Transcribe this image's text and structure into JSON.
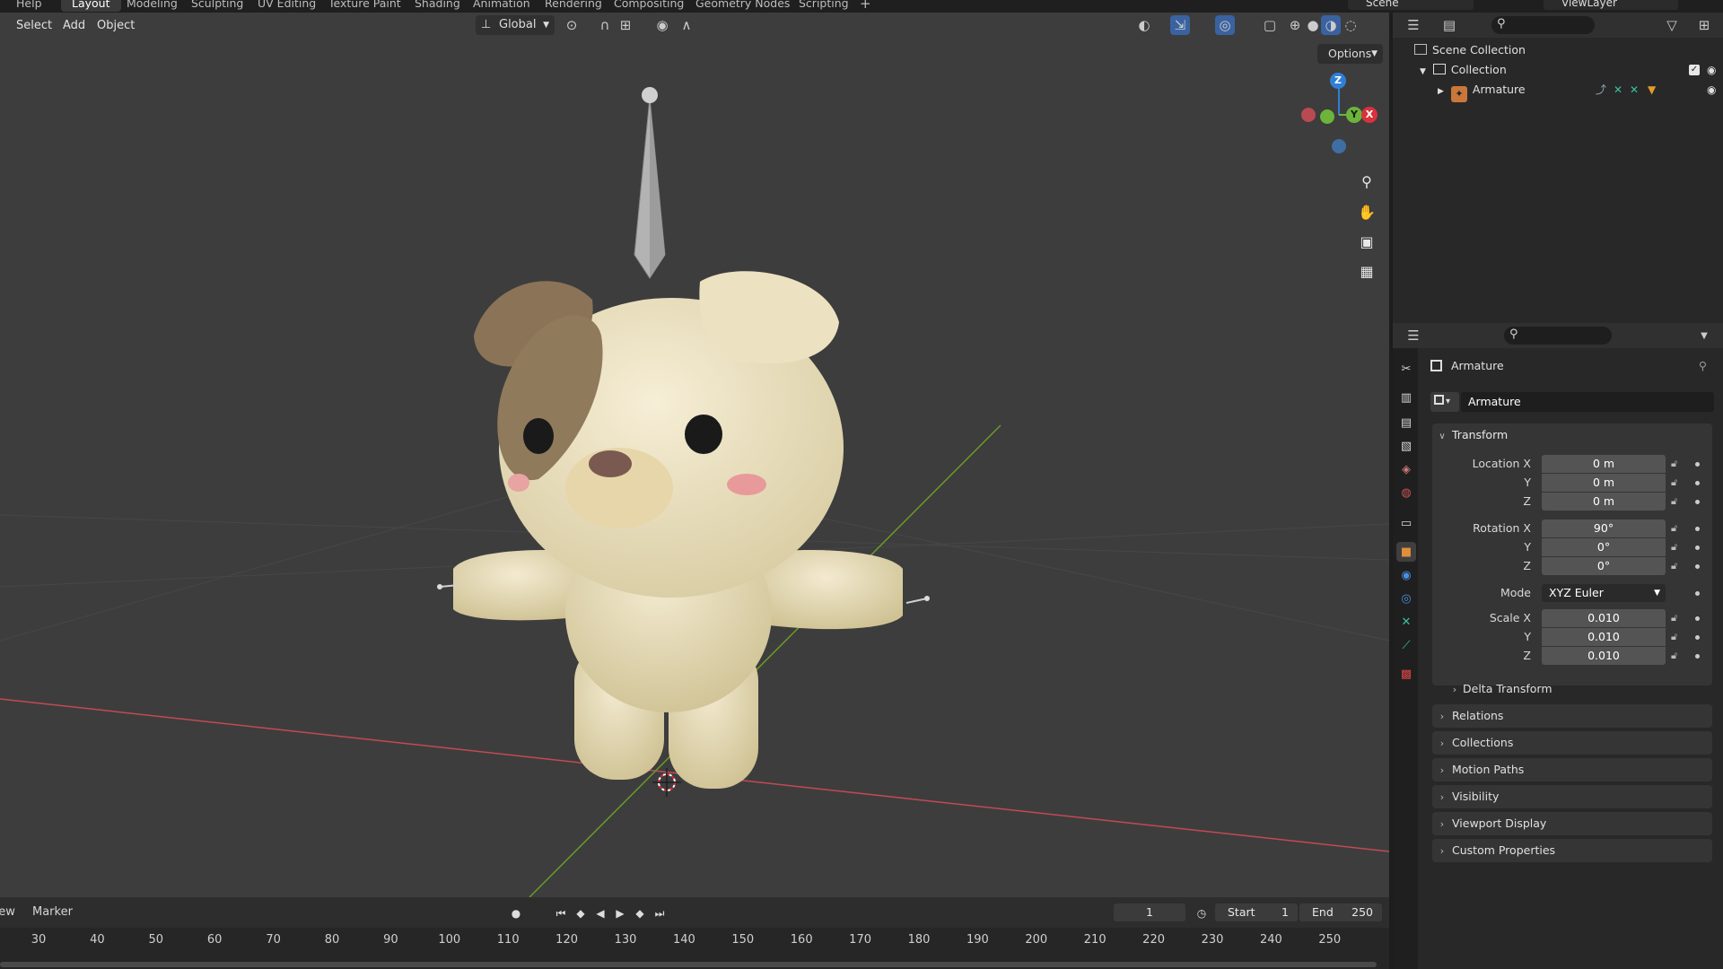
{
  "topbar": {
    "help": "Help",
    "workspaces": [
      "Layout",
      "Modeling",
      "Sculpting",
      "UV Editing",
      "Texture Paint",
      "Shading",
      "Animation",
      "Rendering",
      "Compositing",
      "Geometry Nodes",
      "Scripting"
    ],
    "add_tab": "+",
    "scene": "Scene",
    "view_layer": "ViewLayer"
  },
  "viewport": {
    "menus": {
      "select": "Select",
      "add": "Add",
      "object": "Object"
    },
    "orientation": "Global",
    "options": "Options",
    "gizmo": {
      "x": "X",
      "y": "Y",
      "z": "Z"
    }
  },
  "outliner": {
    "scene_collection": "Scene Collection",
    "collection": "Collection",
    "armature": "Armature"
  },
  "properties": {
    "object_name_header": "Armature",
    "object_name_field": "Armature",
    "transform": {
      "title": "Transform",
      "location_label": "Location X",
      "location": {
        "x": "0 m",
        "y": "0 m",
        "z": "0 m"
      },
      "rotation_label": "Rotation X",
      "rotation": {
        "x": "90°",
        "y": "0°",
        "z": "0°"
      },
      "mode_label": "Mode",
      "mode": "XYZ Euler",
      "scale_label": "Scale X",
      "scale": {
        "x": "0.010",
        "y": "0.010",
        "z": "0.010"
      },
      "y_label": "Y",
      "z_label": "Z",
      "delta": "Delta Transform"
    },
    "sections": [
      "Relations",
      "Collections",
      "Motion Paths",
      "Visibility",
      "Viewport Display",
      "Custom Properties"
    ]
  },
  "timeline": {
    "view": "View",
    "marker": "Marker",
    "current_frame": "1",
    "start_label": "Start",
    "start": "1",
    "end_label": "End",
    "end": "250",
    "ticks": [
      "30",
      "40",
      "50",
      "60",
      "70",
      "80",
      "90",
      "100",
      "110",
      "120",
      "130",
      "140",
      "150",
      "160",
      "170",
      "180",
      "190",
      "200",
      "210",
      "220",
      "230",
      "240",
      "250"
    ]
  },
  "colors": {
    "viewport_bg": "#3d3d3d",
    "x_axis": "#c14a55",
    "y_axis": "#6a9a2a",
    "gizmo_z": "#2f7fd6",
    "gizmo_y": "#6cb43a",
    "gizmo_x": "#d6333d",
    "active_tab": "#e08f3a"
  }
}
